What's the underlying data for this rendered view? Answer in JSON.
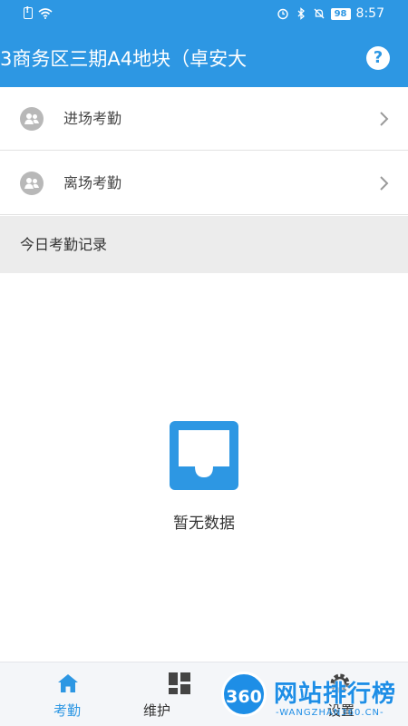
{
  "status_bar": {
    "battery": "98",
    "time": "8:57"
  },
  "header": {
    "title": "3商务区三期A4地块（卓安大"
  },
  "menu": {
    "items": [
      {
        "label": "进场考勤"
      },
      {
        "label": "离场考勤"
      }
    ]
  },
  "section": {
    "title": "今日考勤记录"
  },
  "empty_state": {
    "text": "暂无数据"
  },
  "tabbar": {
    "tabs": [
      {
        "label": "考勤",
        "active": true
      },
      {
        "label": "维护",
        "active": false
      },
      {
        "label": "设置",
        "active": false
      }
    ]
  },
  "watermark": {
    "logo": "360",
    "text": "网站排行榜",
    "sub": "-WANGZHAN360.CN-"
  },
  "colors": {
    "primary": "#2d97e3",
    "section_bg": "#ececec",
    "icon_gray": "#b8b8b8"
  },
  "icons": {
    "help": "question-circle-icon",
    "menu": "group-user-icon",
    "chevron": "chevron-right-icon",
    "empty": "empty-tray-icon",
    "home": "home-icon",
    "maintain": "grid-icon",
    "settings": "gear-icon"
  }
}
